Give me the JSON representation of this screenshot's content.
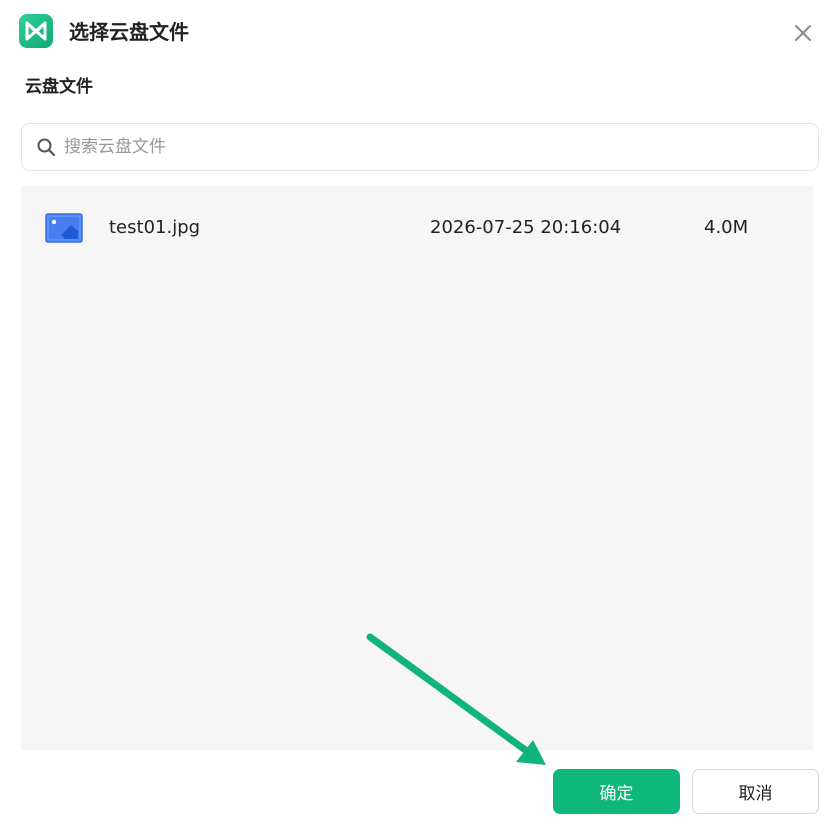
{
  "dialog": {
    "title": "选择云盘文件",
    "logo_icon": "mindmaster-logo-icon",
    "close_icon": "close-icon"
  },
  "section": {
    "label": "云盘文件"
  },
  "search": {
    "placeholder": "搜索云盘文件",
    "value": "",
    "icon": "search-icon"
  },
  "files": [
    {
      "icon": "image-file-icon",
      "name": "test01.jpg",
      "modified": "2026-07-25 20:16:04",
      "size": "4.0M"
    }
  ],
  "buttons": {
    "confirm_label": "确定",
    "cancel_label": "取消"
  },
  "colors": {
    "accent": "#0fb77a",
    "list_background": "#f6f6f6",
    "annotation_arrow": "#10b47a"
  }
}
